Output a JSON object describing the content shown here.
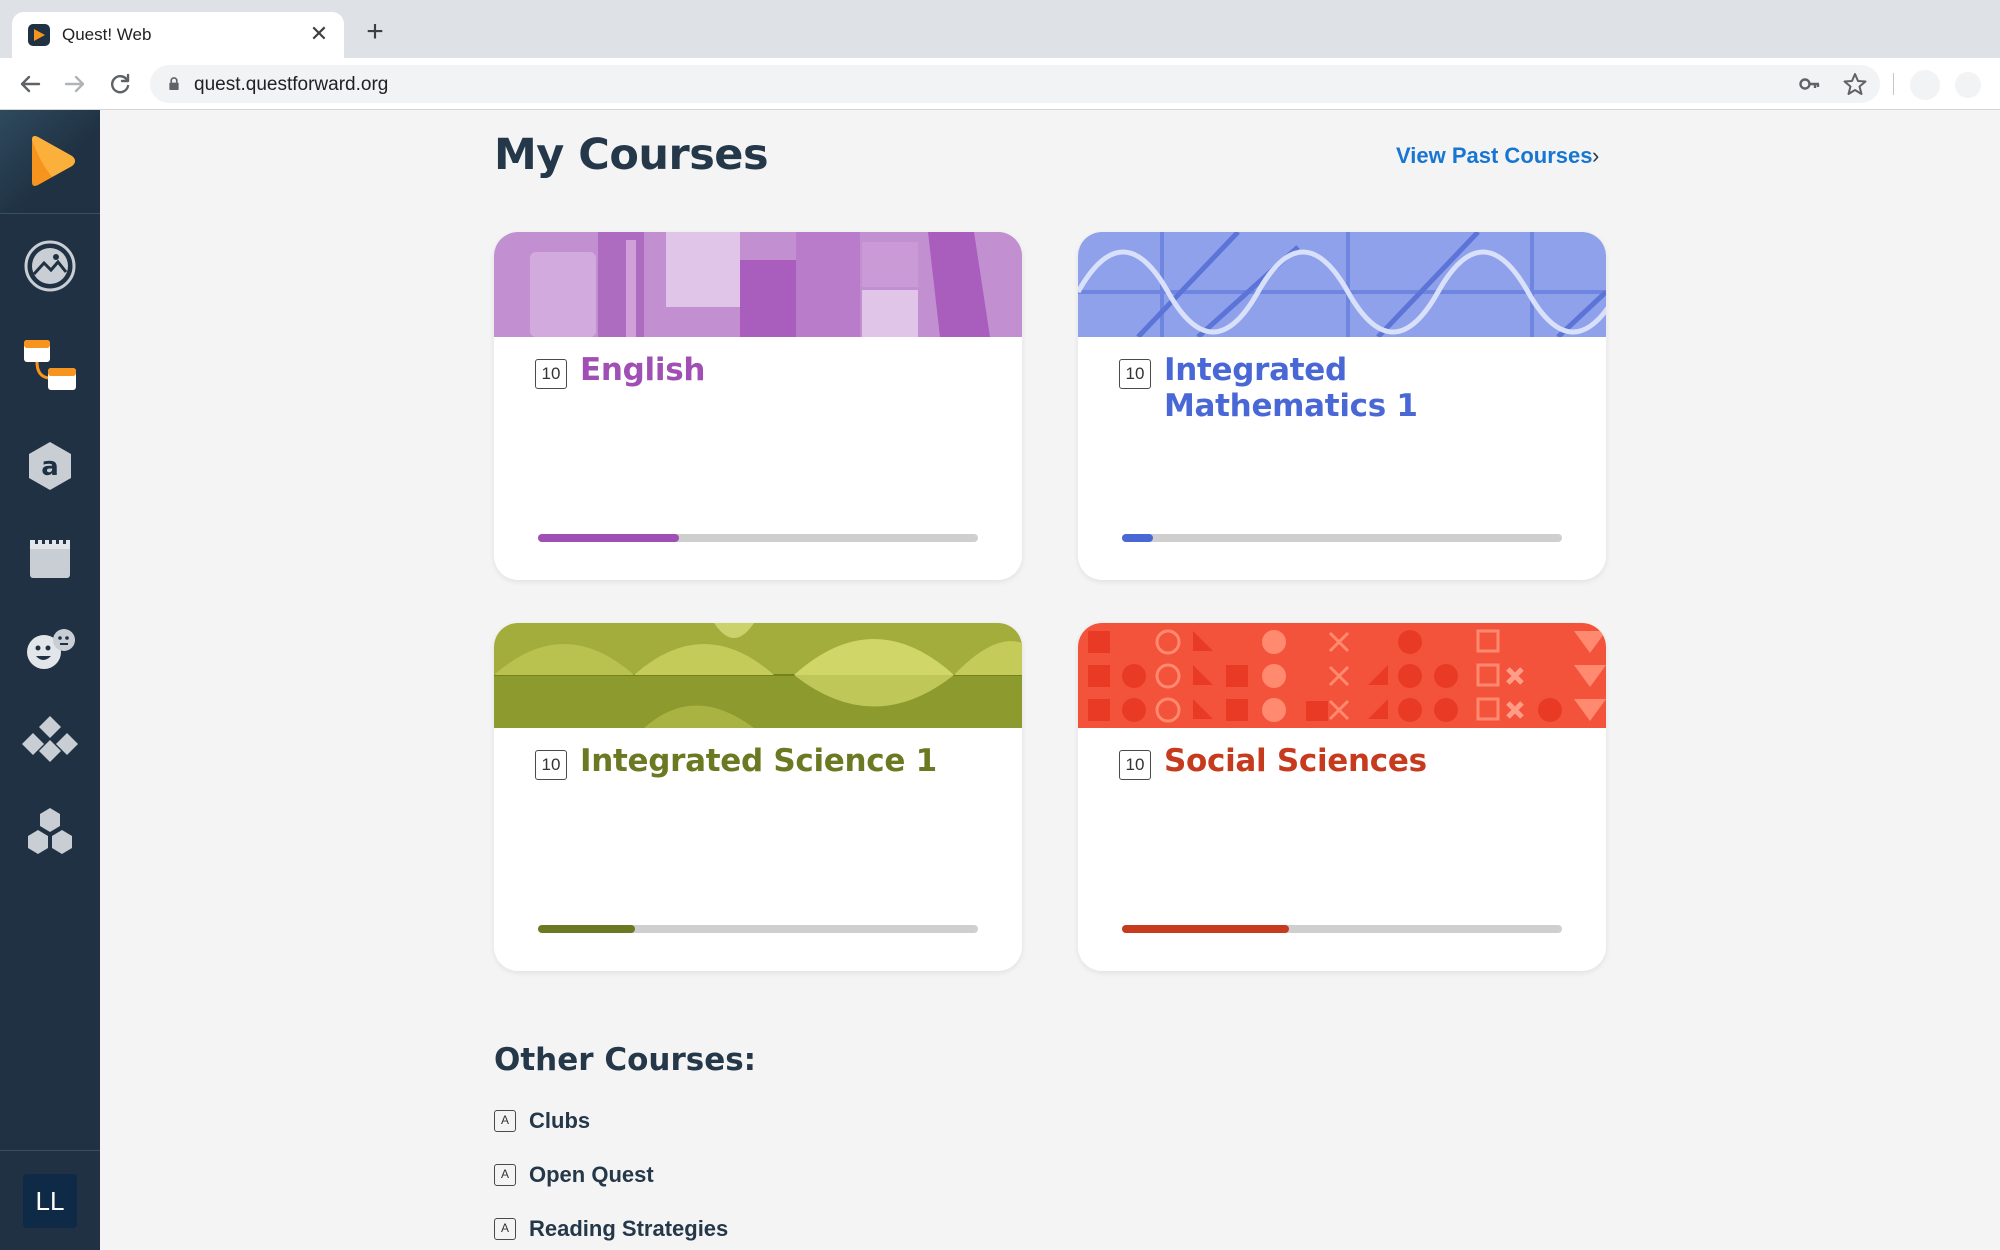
{
  "browser": {
    "tab_title": "Quest! Web",
    "tab_close": "✕",
    "new_tab": "+",
    "url": "quest.questforward.org"
  },
  "sidebar": {
    "items": [
      {
        "name": "logo",
        "icon": "quest-logo-icon"
      },
      {
        "name": "dashboard",
        "icon": "gallery-icon"
      },
      {
        "name": "courses",
        "icon": "courses-icon"
      },
      {
        "name": "assessments",
        "icon": "hexagon-a-icon"
      },
      {
        "name": "calendar",
        "icon": "calendar-icon"
      },
      {
        "name": "community",
        "icon": "faces-icon"
      },
      {
        "name": "tools",
        "icon": "diamonds-icon"
      },
      {
        "name": "resources",
        "icon": "hexagons-icon"
      }
    ],
    "avatar_initials": "LL"
  },
  "main": {
    "title": "My Courses",
    "view_past_label": "View Past Courses",
    "view_past_chevron": "›",
    "courses": [
      {
        "grade": "10",
        "title": "English",
        "color": "#a04fb4",
        "progress": 0.32
      },
      {
        "grade": "10",
        "title": "Integrated Mathematics 1",
        "color": "#4a67d6",
        "progress": 0.07
      },
      {
        "grade": "10",
        "title": "Integrated Science 1",
        "color": "#6b7a22",
        "progress": 0.22
      },
      {
        "grade": "10",
        "title": "Social Sciences",
        "color": "#c63a1e",
        "progress": 0.38
      }
    ],
    "other_title": "Other Courses:",
    "other_courses": [
      {
        "badge": "A",
        "label": "Clubs"
      },
      {
        "badge": "A",
        "label": "Open Quest"
      },
      {
        "badge": "A",
        "label": "Reading Strategies"
      }
    ]
  }
}
